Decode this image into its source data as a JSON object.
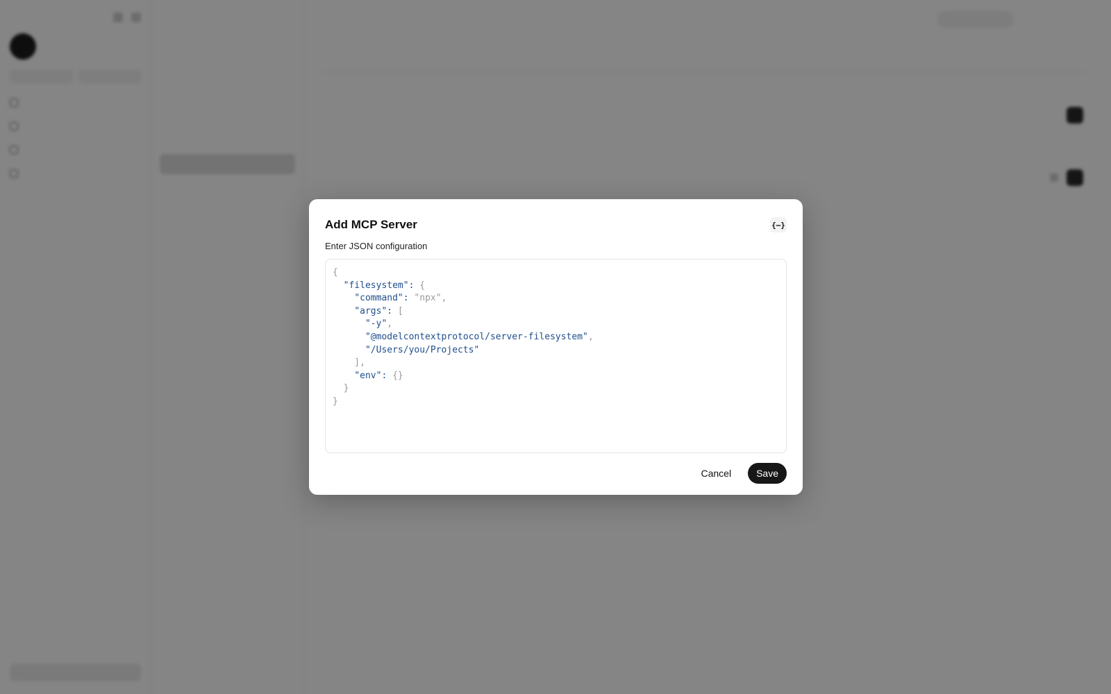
{
  "modal": {
    "title": "Add MCP Server",
    "json_toggle_label": "{–}",
    "field_label": "Enter JSON configuration",
    "editor_value": "{\n  \"filesystem\": {\n    \"command\": \"npx\",\n    \"args\": [\n      \"-y\",\n      \"@modelcontextprotocol/server-filesystem\",\n      \"/Users/you/Projects\"\n    ],\n    \"env\": {}\n  }\n}",
    "editor_lines": [
      {
        "text": "{",
        "kind": "punct"
      },
      {
        "text": "  \"filesystem\": {",
        "kind": "key"
      },
      {
        "text": "    \"command\": \"npx\",",
        "kind": "key"
      },
      {
        "text": "    \"args\": [",
        "kind": "key"
      },
      {
        "text": "      \"-y\",",
        "kind": "string"
      },
      {
        "text": "      \"@modelcontextprotocol/server-filesystem\",",
        "kind": "string"
      },
      {
        "text": "      \"/Users/you/Projects\"",
        "kind": "string"
      },
      {
        "text": "    ],",
        "kind": "punct"
      },
      {
        "text": "    \"env\": {}",
        "kind": "key"
      },
      {
        "text": "  }",
        "kind": "punct"
      },
      {
        "text": "}",
        "kind": "punct"
      }
    ],
    "cancel_label": "Cancel",
    "save_label": "Save"
  },
  "colors": {
    "overlay": "#000000",
    "save_button": "#171717",
    "json_key": "#1f4e8c",
    "json_punct": "#9a9a9a"
  },
  "icons": {
    "json_toggle": "code-braces-icon"
  }
}
